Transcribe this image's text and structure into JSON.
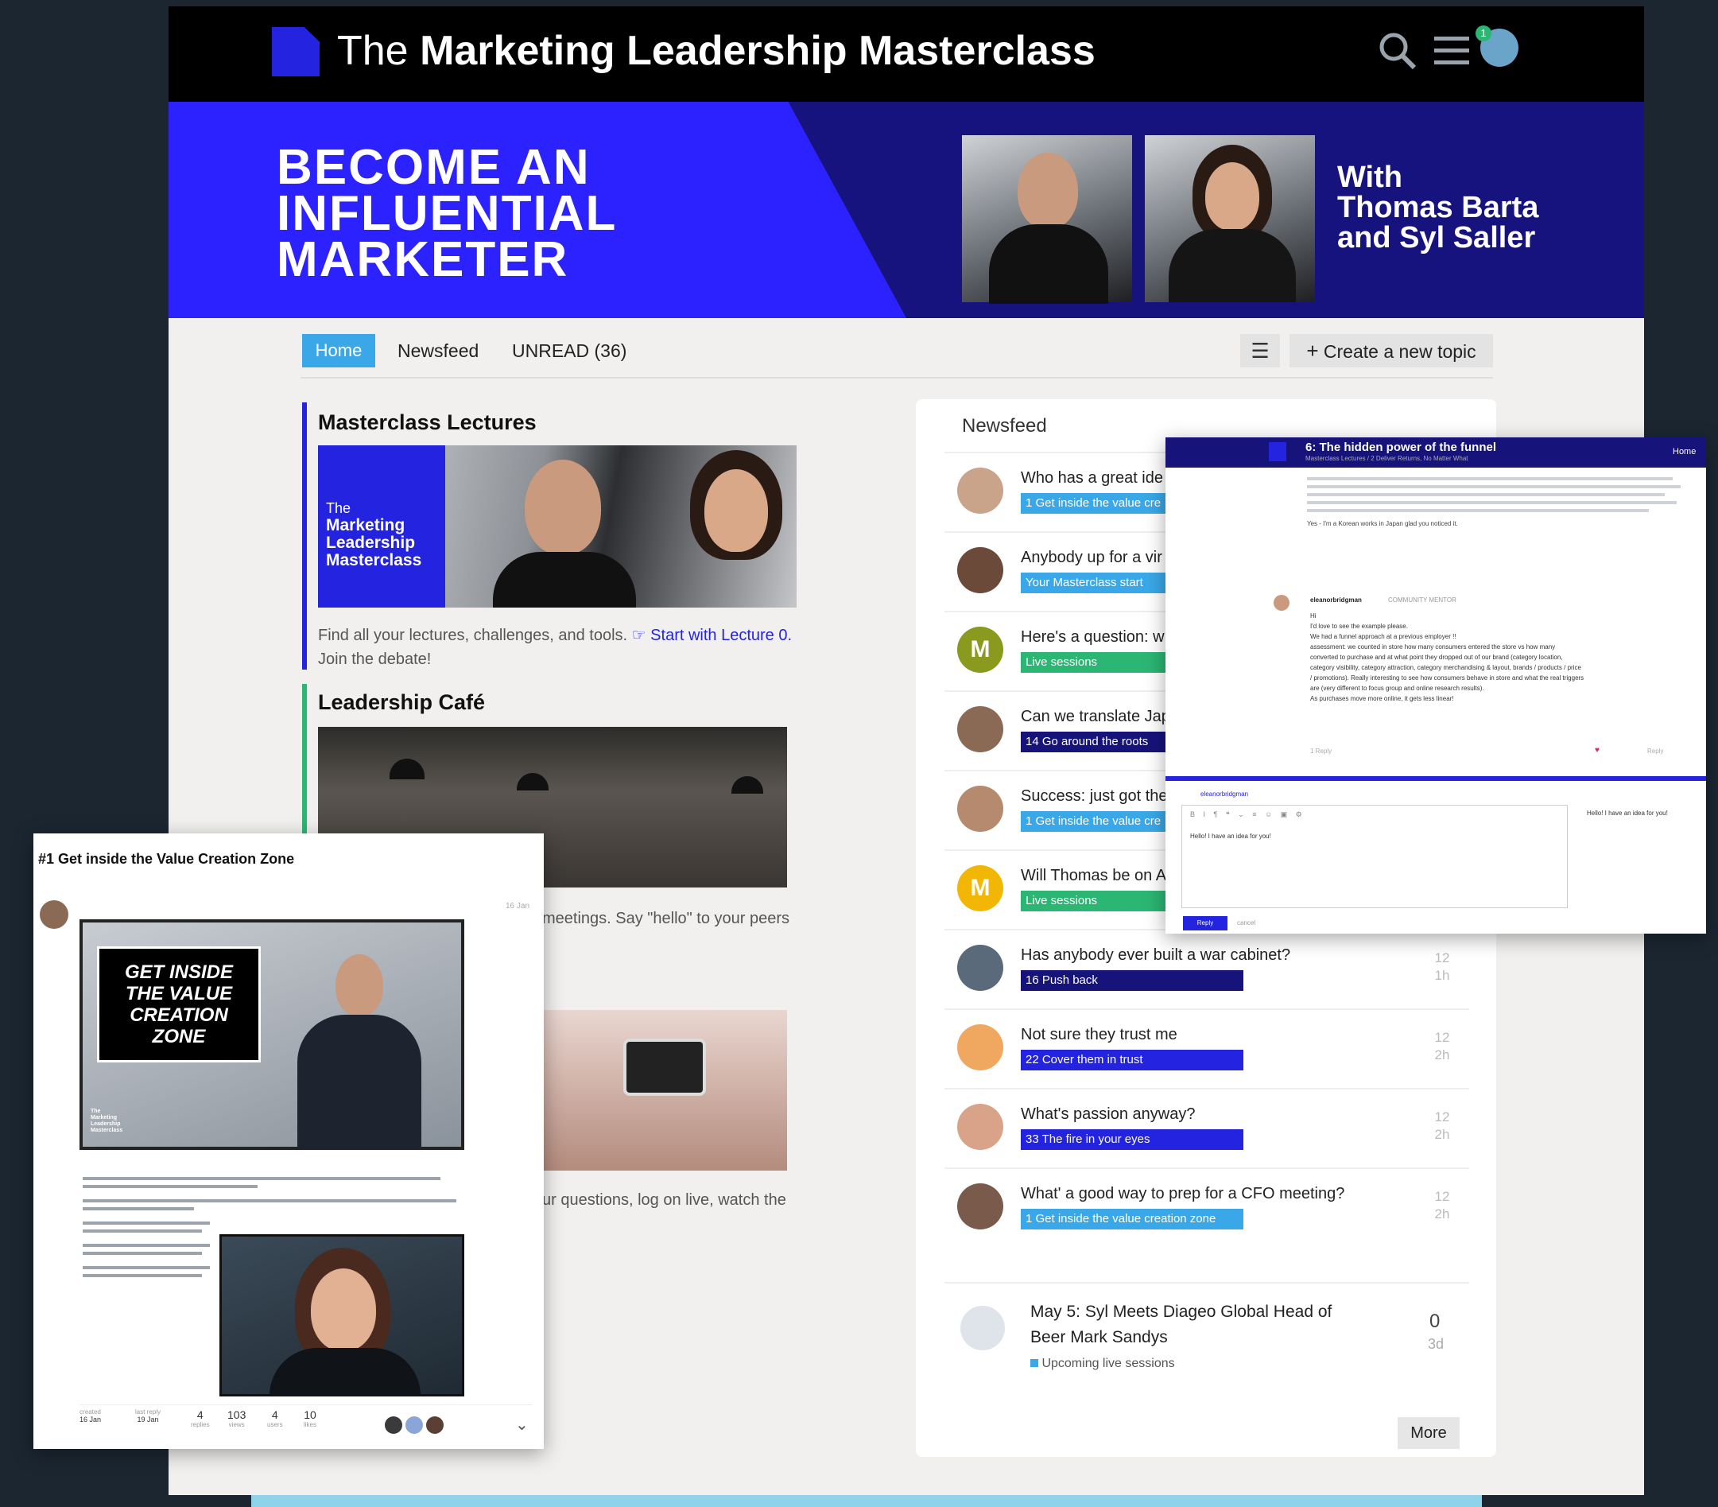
{
  "header": {
    "title_prefix": "The",
    "title_main": "Marketing Leadership Masterclass",
    "notification_count": "1"
  },
  "hero": {
    "headline_lines": [
      "BECOME AN",
      "INFLUENTIAL",
      "MARKETER"
    ],
    "with_lines": [
      "With",
      "Thomas Barta",
      "and Syl Saller"
    ]
  },
  "nav": {
    "tabs": [
      "Home",
      "Newsfeed",
      "UNREAD (36)"
    ],
    "create_label": "Create a new topic"
  },
  "categories": [
    {
      "title": "Masterclass Lectures",
      "thumb_text": [
        "The",
        "Marketing",
        "Leadership",
        "Masterclass"
      ],
      "desc_prefix": "Find all your lectures, challenges, and tools.",
      "desc_link": "Start with Lecture 0.",
      "desc_suffix": "Join the debate!",
      "color": "#2323e0"
    },
    {
      "title": "Leadership Café",
      "desc_fragment": "meetings. Say \"hello\" to your peers",
      "color": "#2bb673"
    },
    {
      "desc_fragment": "ur questions, log on live, watch the"
    }
  ],
  "newsfeed": {
    "title": "Newsfeed",
    "rows": [
      {
        "title": "Who has a great ide",
        "tag": "1 Get inside the value cre",
        "tag_color": "#3aa8e8",
        "avatar_color": "#c9a38a"
      },
      {
        "title": "Anybody up for a vir",
        "tag": "Your Masterclass start",
        "tag_color": "#3aa8e8",
        "avatar_color": "#6b4a3a"
      },
      {
        "title": "Here's a question: w",
        "tag": "Live sessions",
        "tag_color": "#2bb673",
        "avatar_letter": "M",
        "avatar_color": "#8a9a1f"
      },
      {
        "title": "Can we translate Jap",
        "tag": "14 Go around the roots",
        "tag_color": "#16137a",
        "avatar_color": "#8a6a55"
      },
      {
        "title": "Success: just got the",
        "tag": "1 Get inside the value cre",
        "tag_color": "#3aa8e8",
        "avatar_color": "#b58a6f"
      },
      {
        "title": "Will Thomas be on A",
        "tag": "Live sessions",
        "tag_color": "#2bb673",
        "avatar_letter": "M",
        "avatar_color": "#f2b705"
      },
      {
        "title": "Has anybody ever built a war cabinet?",
        "tag": "16 Push back",
        "tag_color": "#16137a",
        "meta": [
          "12",
          "1h"
        ],
        "avatar_color": "#5a6a7a"
      },
      {
        "title": "Not sure they trust me",
        "tag": "22 Cover them in trust",
        "tag_color": "#2323e0",
        "meta": [
          "12",
          "2h"
        ],
        "avatar_color": "#f0a860"
      },
      {
        "title": "What's passion anyway?",
        "tag": "33 The fire in your eyes",
        "tag_color": "#2323e0",
        "meta": [
          "12",
          "2h"
        ],
        "avatar_color": "#d9a38a"
      },
      {
        "title": "What' a good way to prep for a CFO meeting?",
        "tag": "1 Get inside the value creation zone",
        "tag_color": "#3aa8e8",
        "meta": [
          "12",
          "2h"
        ],
        "avatar_color": "#7a5a4a"
      }
    ],
    "event": {
      "title_lines": [
        "May 5: Syl Meets Diageo Global Head of",
        "Beer Mark Sandys"
      ],
      "category": "Upcoming live sessions",
      "count": "0",
      "age": "3d"
    },
    "more_label": "More"
  },
  "popup": {
    "title": "6: The hidden power of the funnel",
    "home_label": "Home",
    "crumbs": "Masterclass Lectures  /  2 Deliver Returns, No Matter What",
    "body_text": "Yes - I'm a Korean works in Japan glad you noticed it.",
    "reply_user": "eleanorbridgman",
    "reply_role": "COMMUNITY MENTOR",
    "reply_lines": [
      "Hi",
      "I'd love to see the example please.",
      "We had a funnel approach at a previous employer !!",
      "assessment: we counted in store how many consumers entered the store vs how many",
      "converted to purchase and at what point they dropped out of our brand (category location,",
      "category visibility, category attraction, category merchandising & layout, brands / products / price",
      "/ promotions). Really interesting to see how consumers behave in store and what the real triggers",
      "are (very different to focus group and online research results).",
      "As purchases move more online, it gets less linear!"
    ],
    "reply_actions": [
      "1 Reply",
      "Reply"
    ],
    "composer_user": "eleanorbridgman",
    "composer_text": "Hello! I have an idea for you!",
    "preview_text": "Hello! I have an idea for you!",
    "reply_button": "Reply",
    "cancel_label": "cancel"
  },
  "lecture": {
    "title": "#1 Get inside the Value Creation Zone",
    "date": "16 Jan",
    "video_caption": [
      "GET INSIDE",
      "THE VALUE",
      "CREATION",
      "ZONE"
    ],
    "video_brand": [
      "The",
      "Marketing",
      "Leadership",
      "Masterclass"
    ],
    "stats": [
      {
        "label": "created",
        "value": "16 Jan"
      },
      {
        "label": "last reply",
        "value": "19 Jan"
      },
      {
        "label": "replies",
        "value": "4"
      },
      {
        "label": "views",
        "value": "103"
      },
      {
        "label": "users",
        "value": "4"
      },
      {
        "label": "likes",
        "value": "10"
      }
    ]
  }
}
